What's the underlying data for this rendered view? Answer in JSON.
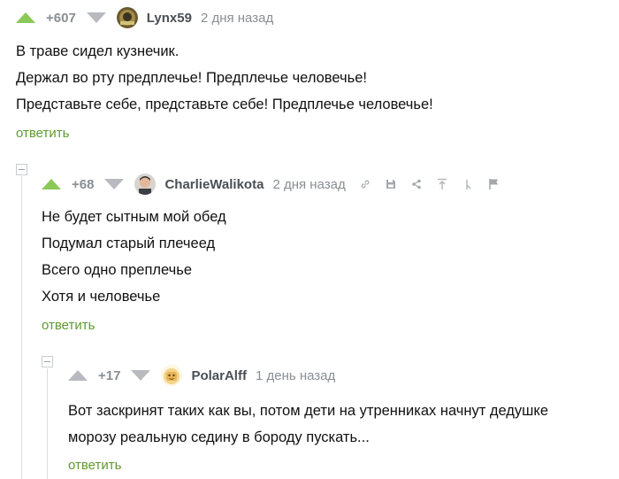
{
  "colors": {
    "accent_green": "#8ac858",
    "reply_green": "#5f9a2f",
    "muted_gray": "#8a8e92",
    "author_gray": "#4a4f54"
  },
  "comments": [
    {
      "rating": "+607",
      "author": "Lynx59",
      "time": "2 дня назад",
      "lines": [
        "В траве сидел кузнечик.",
        "Держал во рту предплечье! Предплечье человечье!",
        "Представьте себе, представьте себе! Предплечье человечье!"
      ],
      "reply_label": "ответить",
      "upvoted": true
    },
    {
      "rating": "+68",
      "author": "CharlieWalikota",
      "time": "2 дня назад",
      "lines": [
        "Не будет сытным мой обед",
        "Подумал старый плечеед",
        "Всего одно преплечье",
        "Хотя и человечье"
      ],
      "reply_label": "ответить",
      "upvoted": true,
      "tools": [
        "link-icon",
        "save-icon",
        "share-icon",
        "scroll-to-parent-icon",
        "branch-icon",
        "flag-icon"
      ]
    },
    {
      "rating": "+17",
      "author": "PolarAlff",
      "time": "1 день назад",
      "lines": [
        "Вот заскринят таких как вы, потом дети на утренниках начнут дедушке",
        "морозу реальную седину в бороду пускать..."
      ],
      "reply_label": "ответить",
      "upvoted": false
    }
  ]
}
